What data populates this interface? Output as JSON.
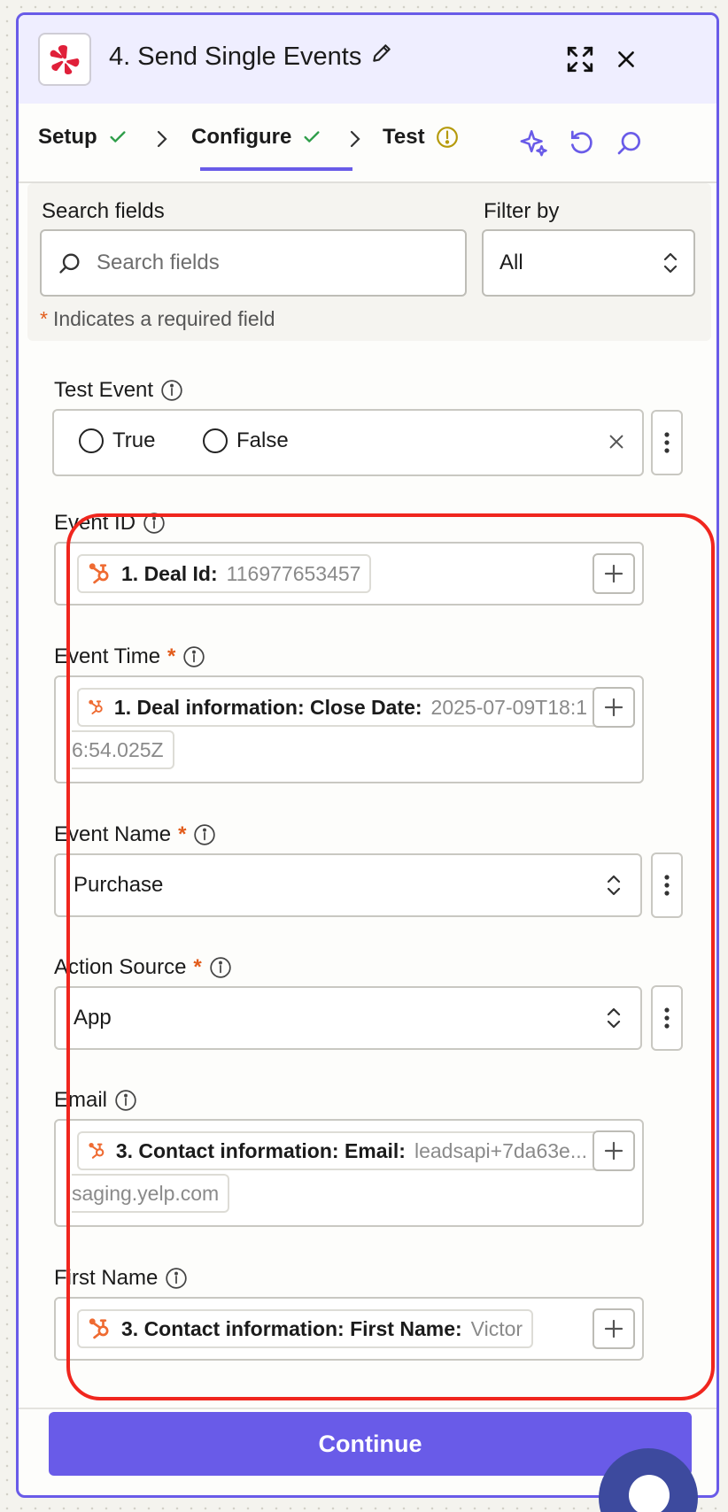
{
  "header": {
    "title": "4. Send Single Events",
    "colors": {
      "accent": "#695be8",
      "header_bg": "#efeeff",
      "logo_red": "#e0203a"
    }
  },
  "tabs": [
    {
      "label": "Setup",
      "status": "complete"
    },
    {
      "label": "Configure",
      "status": "complete"
    },
    {
      "label": "Test",
      "status": "warning"
    }
  ],
  "search": {
    "label": "Search fields",
    "placeholder": "Search fields",
    "filter_label": "Filter by",
    "filter_value": "All",
    "required_note": "Indicates a required field",
    "required_star": "*"
  },
  "fields": {
    "test_event": {
      "label": "Test Event",
      "options": [
        "True",
        "False"
      ]
    },
    "event_id": {
      "label": "Event ID",
      "pill_label": "1. Deal Id:",
      "pill_value": "116977653457"
    },
    "event_time": {
      "label": "Event Time",
      "required": "*",
      "pill_label": "1. Deal information: Close Date:",
      "pill_value": "2025-07-09T18:1",
      "pill_value_cont": "6:54.025Z"
    },
    "event_name": {
      "label": "Event Name",
      "required": "*",
      "value": "Purchase"
    },
    "action_source": {
      "label": "Action Source",
      "required": "*",
      "value": "App"
    },
    "email": {
      "label": "Email",
      "pill_label": "3. Contact information: Email:",
      "pill_value": "leadsapi+7da63e...",
      "pill_value_cont": "saging.yelp.com"
    },
    "first_name": {
      "label": "First Name",
      "pill_label": "3. Contact information: First Name:",
      "pill_value": "Victor"
    }
  },
  "footer": {
    "continue_label": "Continue"
  }
}
